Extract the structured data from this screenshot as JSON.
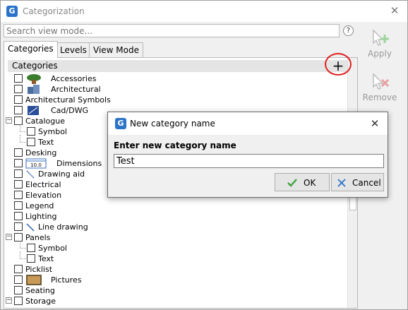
{
  "window": {
    "title": "Categorization",
    "app_icon_letter": "G"
  },
  "search": {
    "placeholder": "Search view mode..."
  },
  "help_label": "?",
  "tabs": [
    {
      "label": "Categories",
      "active": true
    },
    {
      "label": "Levels",
      "active": false
    },
    {
      "label": "View Mode",
      "active": false
    }
  ],
  "panel": {
    "header": "Categories",
    "add_label": "+"
  },
  "tree": [
    {
      "label": "Accessories",
      "indent": 0,
      "thumb": "plant"
    },
    {
      "label": "Architectural",
      "indent": 0,
      "thumb": "blocks"
    },
    {
      "label": "Architectural Symbols",
      "indent": 0,
      "thumb": ""
    },
    {
      "label": "Cad/DWG",
      "indent": 0,
      "thumb": "cad"
    },
    {
      "label": "Catalogue",
      "indent": 0,
      "thumb": "",
      "expander": "⊟"
    },
    {
      "label": "Symbol",
      "indent": 1,
      "thumb": ""
    },
    {
      "label": "Text",
      "indent": 1,
      "thumb": ""
    },
    {
      "label": "Desking",
      "indent": 0,
      "thumb": ""
    },
    {
      "label": "Dimensions",
      "indent": 0,
      "thumb": "dimension"
    },
    {
      "label": "Drawing aid",
      "indent": 0,
      "thumb": "drawing"
    },
    {
      "label": "Electrical",
      "indent": 0,
      "thumb": ""
    },
    {
      "label": "Elevation",
      "indent": 0,
      "thumb": ""
    },
    {
      "label": "Legend",
      "indent": 0,
      "thumb": ""
    },
    {
      "label": "Lighting",
      "indent": 0,
      "thumb": ""
    },
    {
      "label": "Line drawing",
      "indent": 0,
      "thumb": "line"
    },
    {
      "label": "Panels",
      "indent": 0,
      "thumb": "",
      "expander": "⊟"
    },
    {
      "label": "Symbol",
      "indent": 1,
      "thumb": ""
    },
    {
      "label": "Text",
      "indent": 1,
      "thumb": ""
    },
    {
      "label": "Picklist",
      "indent": 0,
      "thumb": ""
    },
    {
      "label": "Pictures",
      "indent": 0,
      "thumb": "picture"
    },
    {
      "label": "Seating",
      "indent": 0,
      "thumb": ""
    },
    {
      "label": "Storage",
      "indent": 0,
      "thumb": "",
      "expander": "⊟"
    }
  ],
  "dimension_thumb_text": "10.0",
  "side_buttons": [
    {
      "label": "Apply",
      "icon": "cursor-plus-icon"
    },
    {
      "label": "Remove",
      "icon": "cursor-x-icon"
    }
  ],
  "dialog": {
    "title": "New category name",
    "prompt": "Enter new category name",
    "value": "Test",
    "ok_label": "OK",
    "cancel_label": "Cancel",
    "close_label": "✕"
  },
  "colors": {
    "accent": "#2b73c8",
    "highlight_circle": "#e02020",
    "ok_check": "#3fa33f",
    "cancel_x": "#2b73c8"
  }
}
